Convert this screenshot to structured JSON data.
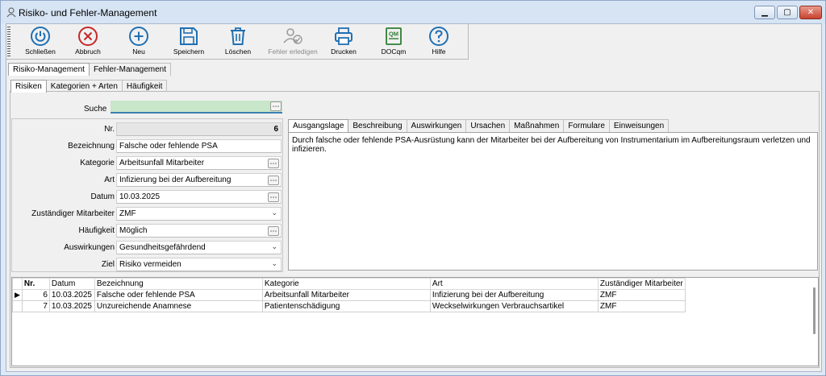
{
  "window": {
    "title": "Risiko- und Fehler-Management",
    "controls": [
      "minimize",
      "maximize",
      "close"
    ]
  },
  "toolbar": {
    "buttons": [
      {
        "label": "Schließen",
        "icon": "power-icon",
        "color": "#1f6fb3",
        "enabled": true
      },
      {
        "label": "Abbruch",
        "icon": "cancel-x-icon",
        "color": "#c62828",
        "enabled": true
      },
      {
        "label": "Neu",
        "icon": "plus-circle-icon",
        "color": "#1f6fb3",
        "enabled": true
      },
      {
        "label": "Speichern",
        "icon": "floppy-disk-icon",
        "color": "#1f6fb3",
        "enabled": true
      },
      {
        "label": "Löschen",
        "icon": "trash-icon",
        "color": "#1f6fb3",
        "enabled": true
      },
      {
        "label": "Fehler erledigen",
        "icon": "user-check-icon",
        "color": "#9a9a9a",
        "enabled": false
      },
      {
        "label": "Drucken",
        "icon": "printer-icon",
        "color": "#1f6fb3",
        "enabled": true
      },
      {
        "label": "DOCqm",
        "icon": "qm-book-icon",
        "color": "#2e7d32",
        "enabled": true
      },
      {
        "label": "Hilfe",
        "icon": "help-icon",
        "color": "#1f6fb3",
        "enabled": true
      }
    ]
  },
  "main_tabs": [
    "Risiko-Management",
    "Fehler-Management"
  ],
  "sub_tabs": [
    "Risiken",
    "Kategorien + Arten",
    "Häufigkeit"
  ],
  "search": {
    "label": "Suche",
    "value": ""
  },
  "form": {
    "fields": [
      {
        "label": "Nr.",
        "value": "6",
        "type": "readonly"
      },
      {
        "label": "Bezeichnung",
        "value": "Falsche oder fehlende PSA",
        "type": "text"
      },
      {
        "label": "Kategorie",
        "value": "Arbeitsunfall Mitarbeiter",
        "type": "picker"
      },
      {
        "label": "Art",
        "value": "Infizierung bei der Aufbereitung",
        "type": "picker"
      },
      {
        "label": "Datum",
        "value": "10.03.2025",
        "type": "picker"
      },
      {
        "label": "Zuständiger Mitarbeiter",
        "value": "ZMF",
        "type": "dropdown"
      },
      {
        "label": "Häufigkeit",
        "value": "Möglich",
        "type": "picker"
      },
      {
        "label": "Auswirkungen",
        "value": "Gesundheitsgefährdend",
        "type": "dropdown"
      },
      {
        "label": "Ziel",
        "value": "Risiko vermeiden",
        "type": "dropdown"
      }
    ]
  },
  "detail": {
    "tabs": [
      "Ausgangslage",
      "Beschreibung",
      "Auswirkungen",
      "Ursachen",
      "Maßnahmen",
      "Formulare",
      "Einweisungen"
    ],
    "active_tab": "Ausgangslage",
    "text": "Durch falsche oder fehlende PSA-Ausrüstung kann der Mitarbeiter bei der Aufbereitung von Instrumentarium im Aufbereitungsraum verletzen und infizieren."
  },
  "grid": {
    "columns": [
      "Nr.",
      "Datum",
      "Bezeichnung",
      "Kategorie",
      "Art",
      "Zuständiger Mitarbeiter"
    ],
    "rows": [
      {
        "selected": true,
        "cells": [
          "6",
          "10.03.2025",
          "Falsche oder fehlende PSA",
          "Arbeitsunfall Mitarbeiter",
          "Infizierung bei der Aufbereitung",
          "ZMF"
        ]
      },
      {
        "selected": false,
        "cells": [
          "7",
          "10.03.2025",
          "Unzureichende Anamnese",
          "Patientenschädigung",
          "Weckselwirkungen Verbrauchsartikel",
          "ZMF"
        ]
      }
    ]
  },
  "colors": {
    "accent": "#1f6fb3",
    "search_bg": "#c8e6c9",
    "title_bar": "#d6e4f4"
  }
}
